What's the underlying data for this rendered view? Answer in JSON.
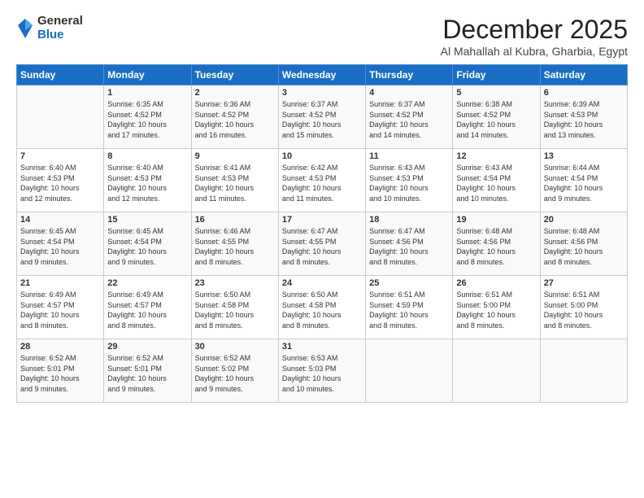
{
  "logo": {
    "general": "General",
    "blue": "Blue"
  },
  "title": "December 2025",
  "location": "Al Mahallah al Kubra, Gharbia, Egypt",
  "days_header": [
    "Sunday",
    "Monday",
    "Tuesday",
    "Wednesday",
    "Thursday",
    "Friday",
    "Saturday"
  ],
  "weeks": [
    [
      {
        "day": "",
        "info": ""
      },
      {
        "day": "1",
        "info": "Sunrise: 6:35 AM\nSunset: 4:52 PM\nDaylight: 10 hours\nand 17 minutes."
      },
      {
        "day": "2",
        "info": "Sunrise: 6:36 AM\nSunset: 4:52 PM\nDaylight: 10 hours\nand 16 minutes."
      },
      {
        "day": "3",
        "info": "Sunrise: 6:37 AM\nSunset: 4:52 PM\nDaylight: 10 hours\nand 15 minutes."
      },
      {
        "day": "4",
        "info": "Sunrise: 6:37 AM\nSunset: 4:52 PM\nDaylight: 10 hours\nand 14 minutes."
      },
      {
        "day": "5",
        "info": "Sunrise: 6:38 AM\nSunset: 4:52 PM\nDaylight: 10 hours\nand 14 minutes."
      },
      {
        "day": "6",
        "info": "Sunrise: 6:39 AM\nSunset: 4:53 PM\nDaylight: 10 hours\nand 13 minutes."
      }
    ],
    [
      {
        "day": "7",
        "info": "Sunrise: 6:40 AM\nSunset: 4:53 PM\nDaylight: 10 hours\nand 12 minutes."
      },
      {
        "day": "8",
        "info": "Sunrise: 6:40 AM\nSunset: 4:53 PM\nDaylight: 10 hours\nand 12 minutes."
      },
      {
        "day": "9",
        "info": "Sunrise: 6:41 AM\nSunset: 4:53 PM\nDaylight: 10 hours\nand 11 minutes."
      },
      {
        "day": "10",
        "info": "Sunrise: 6:42 AM\nSunset: 4:53 PM\nDaylight: 10 hours\nand 11 minutes."
      },
      {
        "day": "11",
        "info": "Sunrise: 6:43 AM\nSunset: 4:53 PM\nDaylight: 10 hours\nand 10 minutes."
      },
      {
        "day": "12",
        "info": "Sunrise: 6:43 AM\nSunset: 4:54 PM\nDaylight: 10 hours\nand 10 minutes."
      },
      {
        "day": "13",
        "info": "Sunrise: 6:44 AM\nSunset: 4:54 PM\nDaylight: 10 hours\nand 9 minutes."
      }
    ],
    [
      {
        "day": "14",
        "info": "Sunrise: 6:45 AM\nSunset: 4:54 PM\nDaylight: 10 hours\nand 9 minutes."
      },
      {
        "day": "15",
        "info": "Sunrise: 6:45 AM\nSunset: 4:54 PM\nDaylight: 10 hours\nand 9 minutes."
      },
      {
        "day": "16",
        "info": "Sunrise: 6:46 AM\nSunset: 4:55 PM\nDaylight: 10 hours\nand 8 minutes."
      },
      {
        "day": "17",
        "info": "Sunrise: 6:47 AM\nSunset: 4:55 PM\nDaylight: 10 hours\nand 8 minutes."
      },
      {
        "day": "18",
        "info": "Sunrise: 6:47 AM\nSunset: 4:56 PM\nDaylight: 10 hours\nand 8 minutes."
      },
      {
        "day": "19",
        "info": "Sunrise: 6:48 AM\nSunset: 4:56 PM\nDaylight: 10 hours\nand 8 minutes."
      },
      {
        "day": "20",
        "info": "Sunrise: 6:48 AM\nSunset: 4:56 PM\nDaylight: 10 hours\nand 8 minutes."
      }
    ],
    [
      {
        "day": "21",
        "info": "Sunrise: 6:49 AM\nSunset: 4:57 PM\nDaylight: 10 hours\nand 8 minutes."
      },
      {
        "day": "22",
        "info": "Sunrise: 6:49 AM\nSunset: 4:57 PM\nDaylight: 10 hours\nand 8 minutes."
      },
      {
        "day": "23",
        "info": "Sunrise: 6:50 AM\nSunset: 4:58 PM\nDaylight: 10 hours\nand 8 minutes."
      },
      {
        "day": "24",
        "info": "Sunrise: 6:50 AM\nSunset: 4:58 PM\nDaylight: 10 hours\nand 8 minutes."
      },
      {
        "day": "25",
        "info": "Sunrise: 6:51 AM\nSunset: 4:59 PM\nDaylight: 10 hours\nand 8 minutes."
      },
      {
        "day": "26",
        "info": "Sunrise: 6:51 AM\nSunset: 5:00 PM\nDaylight: 10 hours\nand 8 minutes."
      },
      {
        "day": "27",
        "info": "Sunrise: 6:51 AM\nSunset: 5:00 PM\nDaylight: 10 hours\nand 8 minutes."
      }
    ],
    [
      {
        "day": "28",
        "info": "Sunrise: 6:52 AM\nSunset: 5:01 PM\nDaylight: 10 hours\nand 9 minutes."
      },
      {
        "day": "29",
        "info": "Sunrise: 6:52 AM\nSunset: 5:01 PM\nDaylight: 10 hours\nand 9 minutes."
      },
      {
        "day": "30",
        "info": "Sunrise: 6:52 AM\nSunset: 5:02 PM\nDaylight: 10 hours\nand 9 minutes."
      },
      {
        "day": "31",
        "info": "Sunrise: 6:53 AM\nSunset: 5:03 PM\nDaylight: 10 hours\nand 10 minutes."
      },
      {
        "day": "",
        "info": ""
      },
      {
        "day": "",
        "info": ""
      },
      {
        "day": "",
        "info": ""
      }
    ]
  ]
}
